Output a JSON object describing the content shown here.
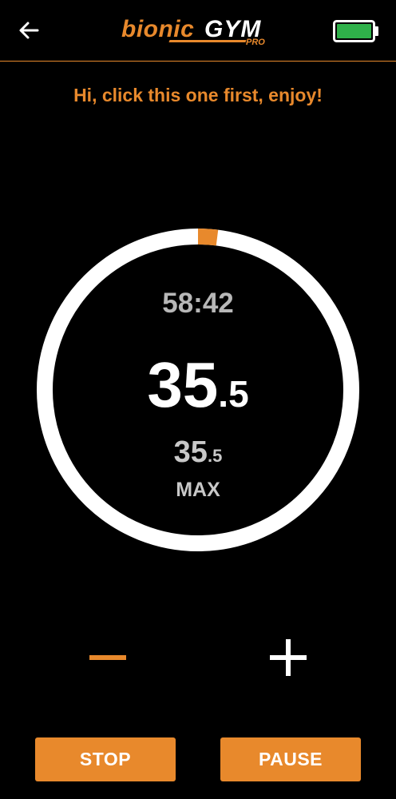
{
  "header": {
    "back_icon": "arrow-left-icon",
    "logo": {
      "text_left": "bionic",
      "text_right": "GYM",
      "text_sub": "PRO"
    },
    "battery_icon": "battery-full-icon",
    "battery_level": 1.0
  },
  "greeting": "Hi, click this one first, enjoy!",
  "gauge": {
    "progress": 0.02,
    "track_color": "#ffffff",
    "progress_color": "#e8892c"
  },
  "timer": "58:42",
  "current_value": {
    "integer": "35",
    "decimal": ".5"
  },
  "max_value": {
    "integer": "35",
    "decimal": ".5",
    "label": "MAX"
  },
  "controls": {
    "minus_icon": "minus-icon",
    "plus_icon": "plus-icon"
  },
  "buttons": {
    "stop_label": "STOP",
    "pause_label": "PAUSE"
  },
  "colors": {
    "accent": "#e8892c",
    "background": "#000000",
    "battery": "#2fb14a"
  }
}
